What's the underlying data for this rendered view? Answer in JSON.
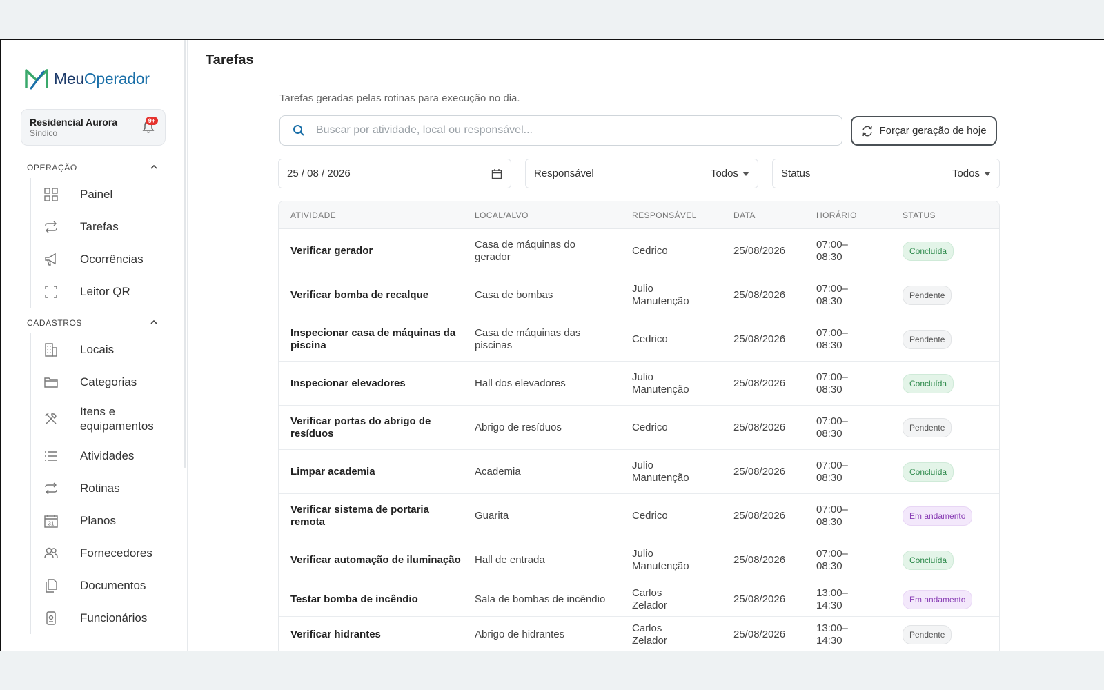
{
  "brand": {
    "name_a": "Meu",
    "name_b": "Operador"
  },
  "org": {
    "name": "Residencial Aurora",
    "role": "Síndico",
    "notifications": "9+"
  },
  "sidebar": {
    "sections": [
      {
        "title": "OPERAÇÃO",
        "items": [
          {
            "label": "Painel",
            "icon": "grid-icon"
          },
          {
            "label": "Tarefas",
            "icon": "repeat-icon"
          },
          {
            "label": "Ocorrências",
            "icon": "megaphone-icon"
          },
          {
            "label": "Leitor QR",
            "icon": "scan-icon"
          }
        ]
      },
      {
        "title": "CADASTROS",
        "items": [
          {
            "label": "Locais",
            "icon": "building-icon"
          },
          {
            "label": "Categorias",
            "icon": "folder-icon"
          },
          {
            "label": "Itens e equipamentos",
            "icon": "tools-icon"
          },
          {
            "label": "Atividades",
            "icon": "list-icon"
          },
          {
            "label": "Rotinas",
            "icon": "repeat-icon"
          },
          {
            "label": "Planos",
            "icon": "calendar-icon"
          },
          {
            "label": "Fornecedores",
            "icon": "users-icon"
          },
          {
            "label": "Documentos",
            "icon": "documents-icon"
          },
          {
            "label": "Funcionários",
            "icon": "badge-icon"
          }
        ]
      }
    ]
  },
  "page": {
    "title": "Tarefas",
    "subtitle": "Tarefas geradas pelas rotinas para execução no dia.",
    "search_placeholder": "Buscar por atividade, local ou responsável...",
    "force_button": "Forçar geração de hoje"
  },
  "filters": {
    "date": "25 / 08 / 2026",
    "responsavel_label": "Responsável",
    "responsavel_value": "Todos",
    "status_label": "Status",
    "status_value": "Todos"
  },
  "table": {
    "columns": [
      "ATIVIDADE",
      "LOCAL/ALVO",
      "RESPONSÁVEL",
      "DATA",
      "HORÁRIO",
      "STATUS"
    ],
    "rows": [
      {
        "atividade": "Verificar gerador",
        "local": "Casa de máquinas do gerador",
        "responsavel": "Cedrico",
        "data": "25/08/2026",
        "horario": "07:00–08:30",
        "status": "Concluída",
        "kind": "done"
      },
      {
        "atividade": "Verificar bomba de recalque",
        "local": "Casa de bombas",
        "responsavel": "Julio Manutenção",
        "data": "25/08/2026",
        "horario": "07:00–08:30",
        "status": "Pendente",
        "kind": "pend"
      },
      {
        "atividade": "Inspecionar casa de máquinas da piscina",
        "local": "Casa de máquinas das piscinas",
        "responsavel": "Cedrico",
        "data": "25/08/2026",
        "horario": "07:00–08:30",
        "status": "Pendente",
        "kind": "pend"
      },
      {
        "atividade": "Inspecionar elevadores",
        "local": "Hall dos elevadores",
        "responsavel": "Julio Manutenção",
        "data": "25/08/2026",
        "horario": "07:00–08:30",
        "status": "Concluída",
        "kind": "done"
      },
      {
        "atividade": "Verificar portas do abrigo de resíduos",
        "local": "Abrigo de resíduos",
        "responsavel": "Cedrico",
        "data": "25/08/2026",
        "horario": "07:00–08:30",
        "status": "Pendente",
        "kind": "pend"
      },
      {
        "atividade": "Limpar academia",
        "local": "Academia",
        "responsavel": "Julio Manutenção",
        "data": "25/08/2026",
        "horario": "07:00–08:30",
        "status": "Concluída",
        "kind": "done"
      },
      {
        "atividade": "Verificar sistema de portaria remota",
        "local": "Guarita",
        "responsavel": "Cedrico",
        "data": "25/08/2026",
        "horario": "07:00–08:30",
        "status": "Em andamento",
        "kind": "prog"
      },
      {
        "atividade": "Verificar automação de iluminação",
        "local": "Hall de entrada",
        "responsavel": "Julio Manutenção",
        "data": "25/08/2026",
        "horario": "07:00–08:30",
        "status": "Concluída",
        "kind": "done"
      },
      {
        "atividade": "Testar bomba de incêndio",
        "local": "Sala de bombas de incêndio",
        "responsavel": "Carlos Zelador",
        "data": "25/08/2026",
        "horario": "13:00–14:30",
        "status": "Em andamento",
        "kind": "prog"
      },
      {
        "atividade": "Verificar hidrantes",
        "local": "Abrigo de hidrantes",
        "responsavel": "Carlos Zelador",
        "data": "25/08/2026",
        "horario": "13:00–14:30",
        "status": "Pendente",
        "kind": "pend"
      }
    ]
  },
  "colors": {
    "brand_green": "#3aa86b",
    "brand_blue": "#1a6fa8",
    "done": "#2e8a4c",
    "pending": "#555555",
    "in_progress": "#8a3fb5",
    "alert": "#e5322d"
  }
}
